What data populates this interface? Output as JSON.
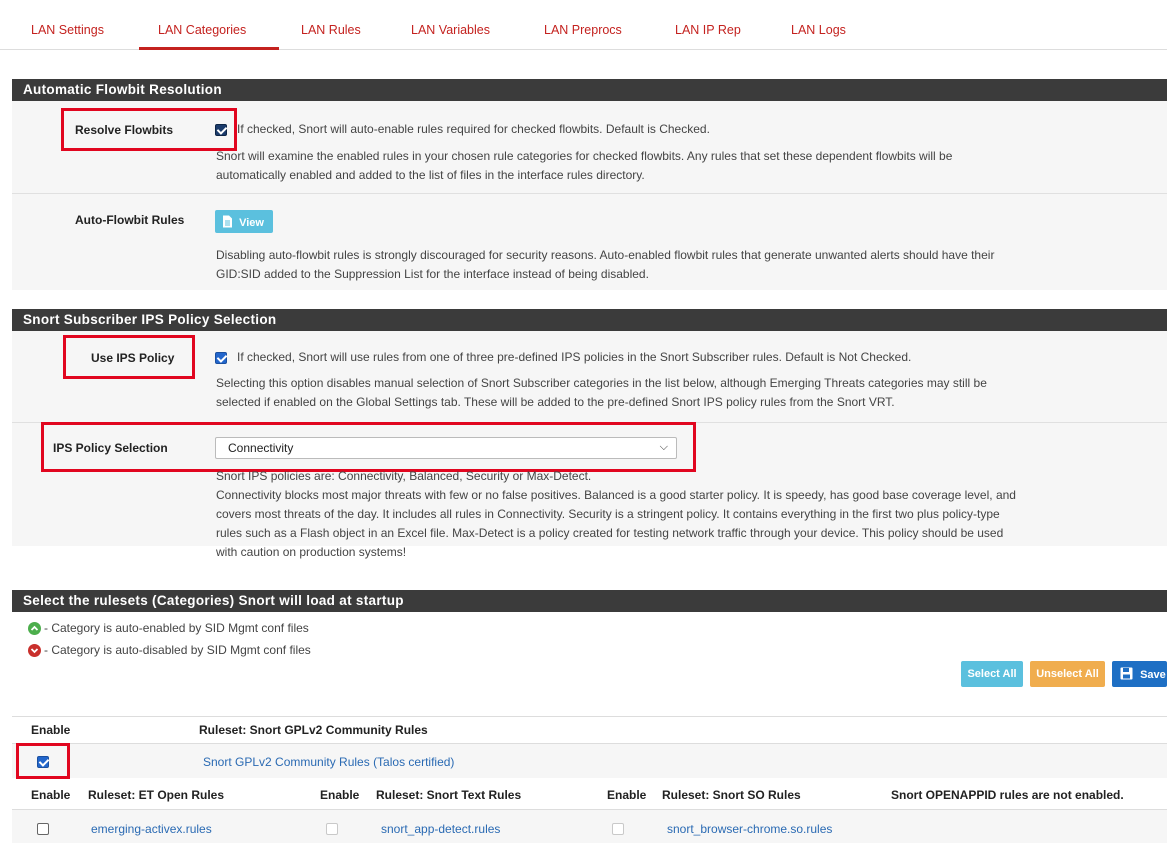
{
  "tabs": [
    {
      "label": "LAN Settings"
    },
    {
      "label": "LAN Categories"
    },
    {
      "label": "LAN Rules"
    },
    {
      "label": "LAN Variables"
    },
    {
      "label": "LAN Preprocs"
    },
    {
      "label": "LAN IP Rep"
    },
    {
      "label": "LAN Logs"
    }
  ],
  "flowbit": {
    "title": "Automatic Flowbit Resolution",
    "resolve_label": "Resolve Flowbits",
    "resolve_line1": "If checked, Snort will auto-enable rules required for checked flowbits. Default is Checked.",
    "resolve_line2": "Snort will examine the enabled rules in your chosen rule categories for checked flowbits. Any rules that set these dependent flowbits will be",
    "resolve_line3": "automatically enabled and added to the list of files in the interface rules directory.",
    "auto_label": "Auto-Flowbit Rules",
    "view_label": "View",
    "auto_line1": "Disabling auto-flowbit rules is strongly discouraged for security reasons. Auto-enabled flowbit rules that generate unwanted alerts should have their",
    "auto_line2": "GID:SID added to the Suppression List for the interface instead of being disabled."
  },
  "ips": {
    "title": "Snort Subscriber IPS Policy Selection",
    "use_label": "Use IPS Policy",
    "use_line1": "If checked, Snort will use rules from one of three pre-defined IPS policies in the Snort Subscriber rules. Default is Not Checked.",
    "use_line2": "Selecting this option disables manual selection of Snort Subscriber categories in the list below, although Emerging Threats categories may still be",
    "use_line3": "selected if enabled on the Global Settings tab. These will be added to the pre-defined Snort IPS policy rules from the Snort VRT.",
    "sel_label": "IPS Policy Selection",
    "sel_value": "Connectivity",
    "sel_line1": "Snort IPS policies are: Connectivity, Balanced, Security or Max-Detect.",
    "sel_line2": "Connectivity blocks most major threats with few or no false positives. Balanced is a good starter policy. It is speedy, has good base coverage level, and",
    "sel_line3": "covers most threats of the day. It includes all rules in Connectivity. Security is a stringent policy. It contains everything in the first two plus policy-type",
    "sel_line4": "rules such as a Flash object in an Excel file. Max-Detect is a policy created for testing network traffic through your device. This policy should be used",
    "sel_line5": "with caution on production systems!"
  },
  "rulesets": {
    "title": "Select the rulesets (Categories) Snort will load at startup",
    "legend_enabled": "- Category is auto-enabled by SID Mgmt conf files",
    "legend_disabled": "- Category is auto-disabled by SID Mgmt conf files",
    "select_all": "Select All",
    "unselect_all": "Unselect All",
    "save": "Save",
    "enable_header": "Enable",
    "community_header": "Ruleset: Snort GPLv2 Community Rules",
    "community_rule": "Snort GPLv2 Community Rules (Talos certified)",
    "col_enable": "Enable",
    "col_et": "Ruleset: ET Open Rules",
    "col_text": "Ruleset: Snort Text Rules",
    "col_so": "Ruleset: Snort SO Rules",
    "col_openappid": "Snort OPENAPPID rules are not enabled.",
    "row1_et": "emerging-activex.rules",
    "row1_text": "snort_app-detect.rules",
    "row1_so": "snort_browser-chrome.so.rules"
  },
  "colors": {
    "accent": "#c4221f",
    "bar": "#3b3b3b",
    "highlight": "#e1061f",
    "info_button": "#5bc0de",
    "warning_button": "#f0ad4e",
    "primary_button": "#1e6fc4",
    "link": "#2a6ab3"
  }
}
